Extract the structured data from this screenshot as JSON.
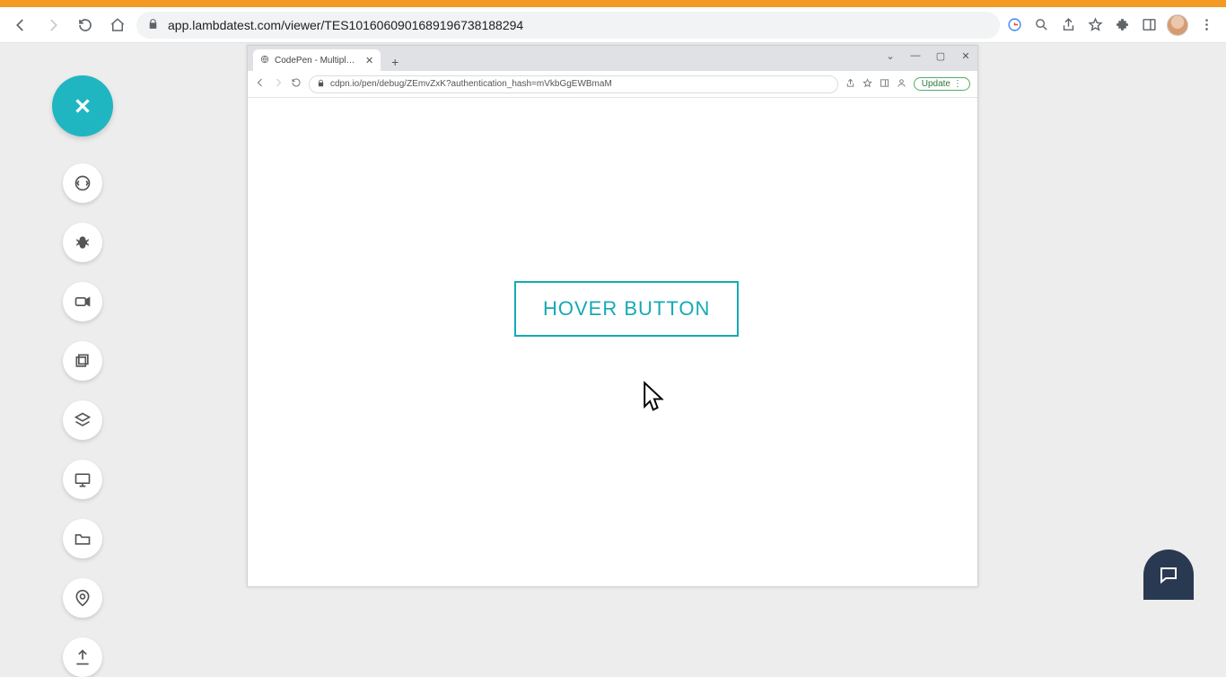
{
  "outer_browser": {
    "url": "app.lambdatest.com/viewer/TES10160609016891967381­88294",
    "right_icons": [
      "google",
      "zoom",
      "share",
      "star",
      "extensions",
      "side-panel",
      "avatar",
      "menu"
    ]
  },
  "lt_sidebar": {
    "close_label": "Close session",
    "tools": [
      "switch",
      "bug",
      "record",
      "gallery",
      "devices",
      "resolution",
      "files",
      "location",
      "upload"
    ]
  },
  "inner_browser": {
    "tab_title": "CodePen - Multiple Button Tran…",
    "url": "cdpn.io/pen/debug/ZEmvZxK?authentication_hash=mVkbGgEWBmaM",
    "update_label": "Update"
  },
  "page": {
    "hover_button_label": "HOVER BUTTON"
  }
}
